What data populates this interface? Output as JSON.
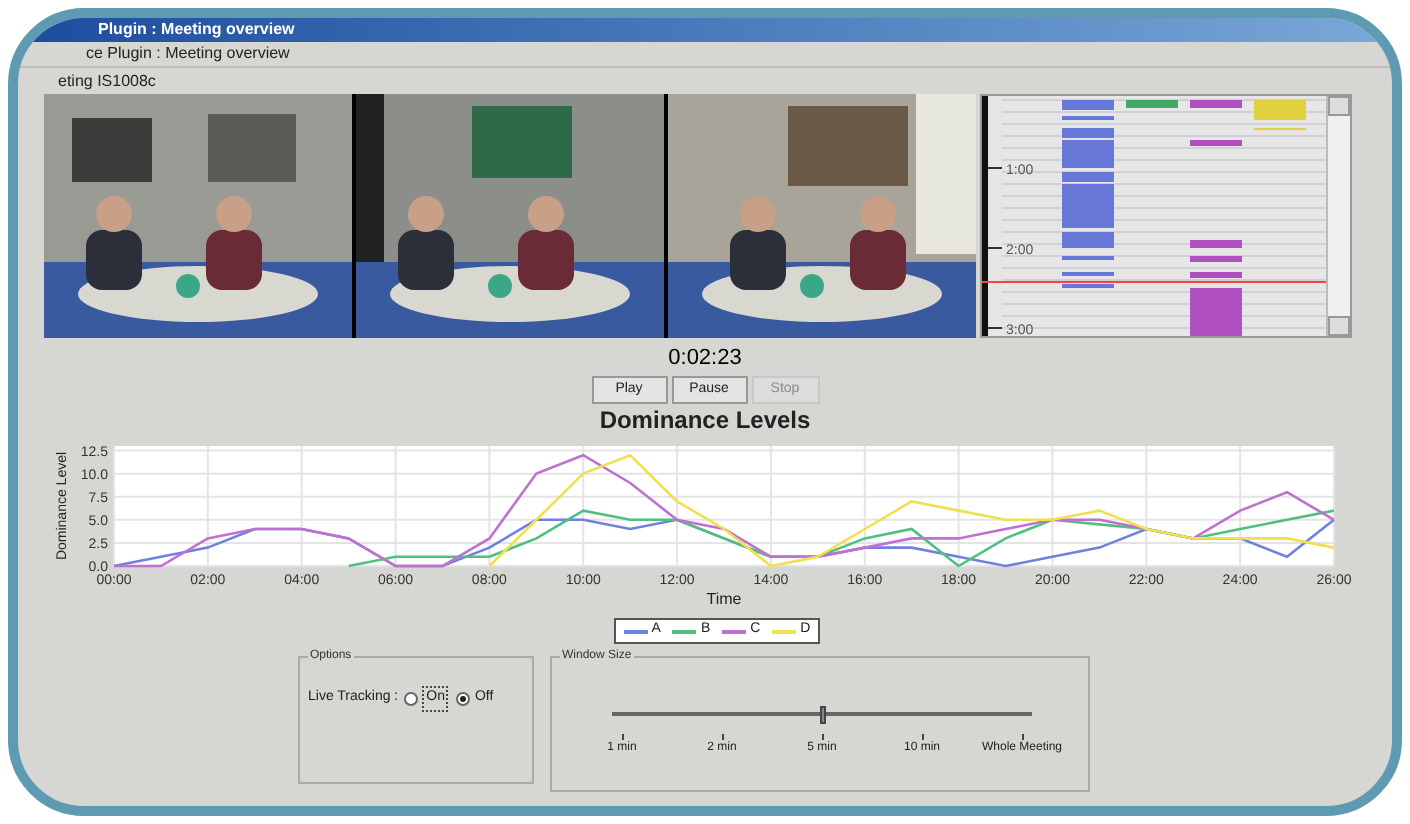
{
  "window": {
    "title": "Plugin : Meeting overview"
  },
  "header": {
    "path": "ce Plugin : Meeting overview",
    "meeting": "eting IS1008c"
  },
  "timeline": {
    "labels": [
      "1:00",
      "2:00",
      "3:00"
    ]
  },
  "playback": {
    "time": "0:02:23",
    "buttons": [
      {
        "label": "Play",
        "disabled": false
      },
      {
        "label": "Pause",
        "disabled": false
      },
      {
        "label": "Stop",
        "disabled": true
      }
    ]
  },
  "chart_data": {
    "type": "line",
    "title": "Dominance Levels",
    "xlabel": "Time",
    "ylabel": "Dominance Level",
    "x": [
      0,
      1,
      2,
      3,
      4,
      5,
      6,
      7,
      8,
      9,
      10,
      11,
      12,
      13,
      14,
      15,
      16,
      17,
      18,
      19,
      20,
      21,
      22,
      23,
      24,
      25,
      26
    ],
    "series": [
      {
        "name": "A",
        "color": "#7080e0",
        "values": [
          0,
          1,
          2,
          4,
          4,
          3,
          0,
          0,
          2,
          5,
          5,
          4,
          5,
          3,
          1,
          1,
          2,
          2,
          1,
          0,
          1,
          2,
          4,
          3,
          3,
          1,
          5
        ]
      },
      {
        "name": "B",
        "color": "#50c080",
        "values": [
          null,
          null,
          null,
          null,
          null,
          0,
          1,
          1,
          1,
          3,
          6,
          5,
          5,
          3,
          1,
          1,
          3,
          4,
          0,
          3,
          5,
          4.5,
          4,
          3,
          4,
          5,
          6
        ]
      },
      {
        "name": "C",
        "color": "#c070d0",
        "values": [
          0,
          0,
          3,
          4,
          4,
          3,
          0,
          0,
          3,
          10,
          12,
          9,
          5,
          4,
          1,
          1,
          2,
          3,
          3,
          4,
          5,
          5,
          4,
          3,
          6,
          8,
          5
        ]
      },
      {
        "name": "D",
        "color": "#f0e050",
        "values": [
          null,
          null,
          null,
          null,
          null,
          null,
          null,
          null,
          0,
          5,
          10,
          12,
          7,
          4,
          0,
          1,
          4,
          7,
          6,
          5,
          5,
          6,
          4,
          3,
          3,
          3,
          2
        ]
      }
    ],
    "grid": true,
    "xlim": [
      0,
      26
    ],
    "ylim": [
      0,
      13
    ],
    "xticks": [
      {
        "value": 0,
        "label": "00:00"
      },
      {
        "value": 2,
        "label": "02:00"
      },
      {
        "value": 4,
        "label": "04:00"
      },
      {
        "value": 6,
        "label": "06:00"
      },
      {
        "value": 8,
        "label": "08:00"
      },
      {
        "value": 10,
        "label": "10:00"
      },
      {
        "value": 12,
        "label": "12:00"
      },
      {
        "value": 14,
        "label": "14:00"
      },
      {
        "value": 16,
        "label": "16:00"
      },
      {
        "value": 18,
        "label": "18:00"
      },
      {
        "value": 20,
        "label": "20:00"
      },
      {
        "value": 22,
        "label": "22:00"
      },
      {
        "value": 24,
        "label": "24:00"
      },
      {
        "value": 26,
        "label": "26:00"
      }
    ],
    "yticks": [
      {
        "value": 0,
        "label": "0.0"
      },
      {
        "value": 2.5,
        "label": "2.5"
      },
      {
        "value": 5,
        "label": "5.0"
      },
      {
        "value": 7.5,
        "label": "7.5"
      },
      {
        "value": 10,
        "label": "10.0"
      },
      {
        "value": 12.5,
        "label": "12.5"
      }
    ]
  },
  "options": {
    "title": "Options",
    "label": "Live Tracking :",
    "radios": [
      {
        "label": "On",
        "selected": false
      },
      {
        "label": "Off",
        "selected": true
      }
    ]
  },
  "window_size": {
    "title": "Window Size",
    "level": 0.5,
    "ticks": [
      "1 min",
      "2 min",
      "5 min",
      "10 min",
      "Whole Meeting"
    ]
  }
}
